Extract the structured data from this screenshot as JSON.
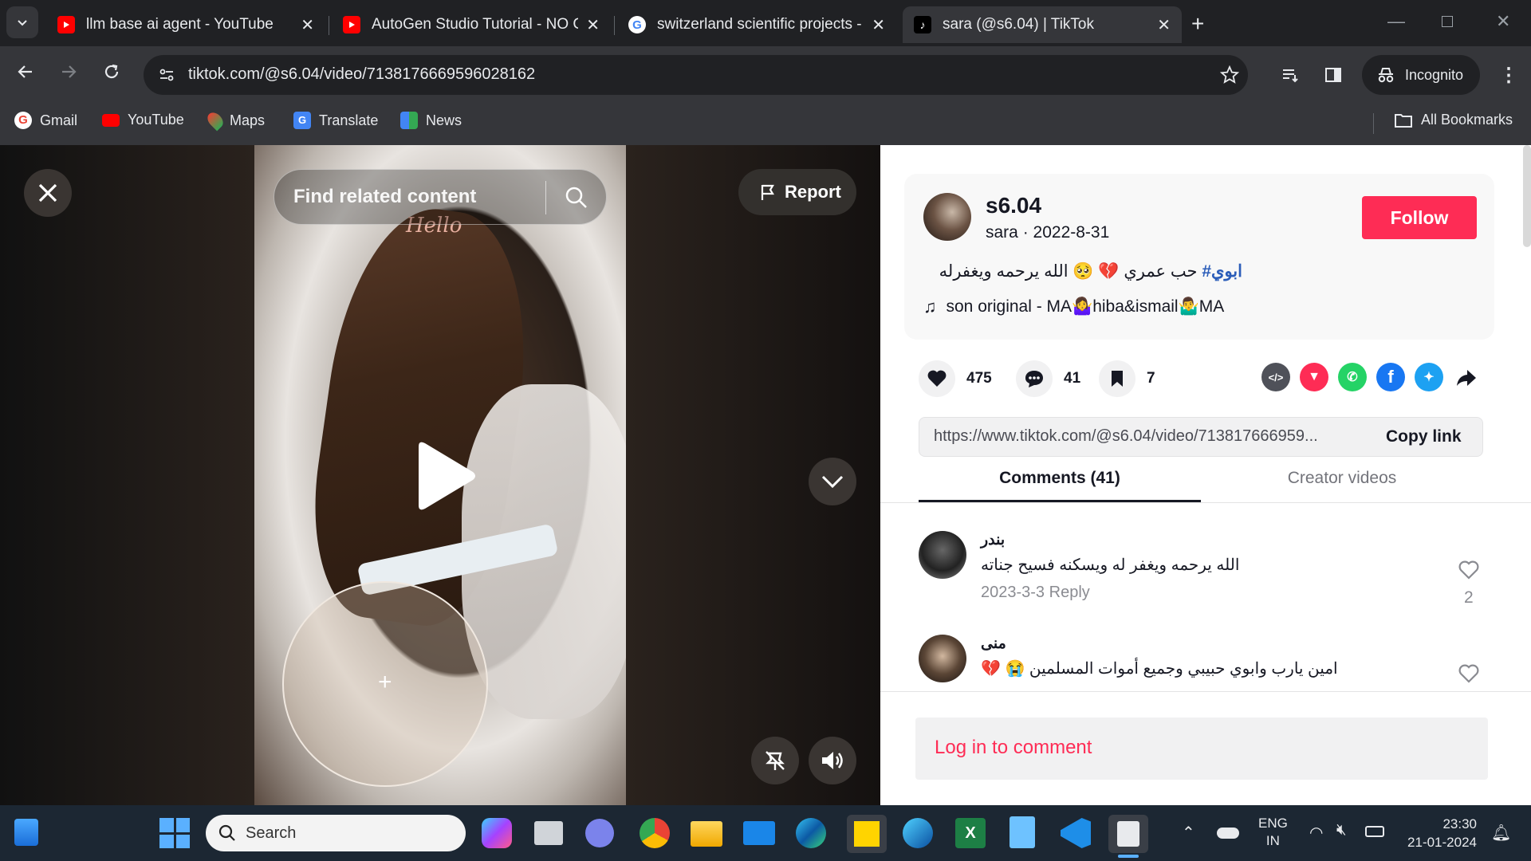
{
  "browser": {
    "tabs": [
      {
        "title": "llm base ai agent - YouTube",
        "icon": "youtube-icon"
      },
      {
        "title": "AutoGen Studio Tutorial - NO C",
        "icon": "youtube-icon"
      },
      {
        "title": "switzerland scientific projects - ",
        "icon": "google-icon"
      },
      {
        "title": "sara (@s6.04) | TikTok",
        "icon": "tiktok-icon"
      }
    ],
    "url": "tiktok.com/@s6.04/video/7138176669596028162",
    "incognito_label": "Incognito",
    "bookmarks": [
      {
        "label": "Gmail"
      },
      {
        "label": "YouTube"
      },
      {
        "label": "Maps"
      },
      {
        "label": "Translate"
      },
      {
        "label": "News"
      }
    ],
    "all_bookmarks_label": "All Bookmarks"
  },
  "video": {
    "search_placeholder": "Find related content",
    "report_label": "Report",
    "overlay_text": "Hello"
  },
  "post": {
    "username": "s6.04",
    "display_name": "sara",
    "date": "2022-8-31",
    "follow_label": "Follow",
    "caption_hashtag": "ابوي#",
    "caption_text": "حب عمري 💔 🥺 الله يرحمه ويغفرله",
    "music": "son original - MA🤷‍♀️hiba&ismail🤷‍♂️MA",
    "likes": "475",
    "comments": "41",
    "saves": "7",
    "share_url": "https://www.tiktok.com/@s6.04/video/713817666959...",
    "copy_link_label": "Copy link",
    "tab_comments": "Comments (41)",
    "tab_creator": "Creator videos",
    "login_label": "Log in to comment"
  },
  "comments_list": [
    {
      "author": "بندر",
      "text": "الله يرحمه ويغفر له ويسكنه فسيح جناته",
      "date": "2023-3-3",
      "reply": "Reply",
      "likes": "2"
    },
    {
      "author": "منى",
      "text": "امين يارب وابوي حبيبي وجميع أموات المسلمين 😭 💔"
    }
  ],
  "taskbar": {
    "search_label": "Search",
    "lang": "ENG",
    "region": "IN",
    "time": "23:30",
    "date": "21-01-2024"
  },
  "colors": {
    "accent": "#fe2c55",
    "hashtag": "#2b5db9",
    "panel_bg": "#ffffff",
    "browser_bg": "#202124"
  }
}
